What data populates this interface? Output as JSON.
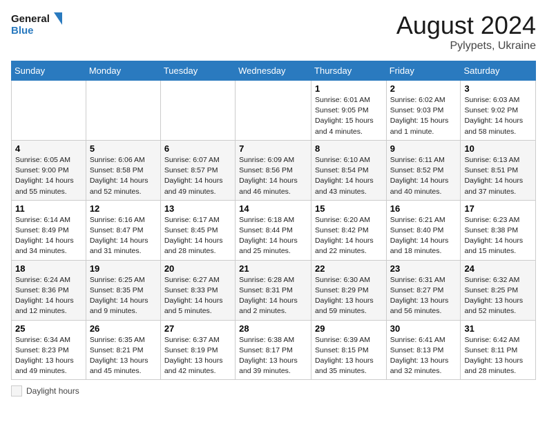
{
  "logo": {
    "line1": "General",
    "line2": "Blue"
  },
  "title": "August 2024",
  "subtitle": "Pylypets, Ukraine",
  "weekdays": [
    "Sunday",
    "Monday",
    "Tuesday",
    "Wednesday",
    "Thursday",
    "Friday",
    "Saturday"
  ],
  "legend_label": "Daylight hours",
  "weeks": [
    [
      {
        "day": "",
        "info": ""
      },
      {
        "day": "",
        "info": ""
      },
      {
        "day": "",
        "info": ""
      },
      {
        "day": "",
        "info": ""
      },
      {
        "day": "1",
        "info": "Sunrise: 6:01 AM\nSunset: 9:05 PM\nDaylight: 15 hours\nand 4 minutes."
      },
      {
        "day": "2",
        "info": "Sunrise: 6:02 AM\nSunset: 9:03 PM\nDaylight: 15 hours\nand 1 minute."
      },
      {
        "day": "3",
        "info": "Sunrise: 6:03 AM\nSunset: 9:02 PM\nDaylight: 14 hours\nand 58 minutes."
      }
    ],
    [
      {
        "day": "4",
        "info": "Sunrise: 6:05 AM\nSunset: 9:00 PM\nDaylight: 14 hours\nand 55 minutes."
      },
      {
        "day": "5",
        "info": "Sunrise: 6:06 AM\nSunset: 8:58 PM\nDaylight: 14 hours\nand 52 minutes."
      },
      {
        "day": "6",
        "info": "Sunrise: 6:07 AM\nSunset: 8:57 PM\nDaylight: 14 hours\nand 49 minutes."
      },
      {
        "day": "7",
        "info": "Sunrise: 6:09 AM\nSunset: 8:56 PM\nDaylight: 14 hours\nand 46 minutes."
      },
      {
        "day": "8",
        "info": "Sunrise: 6:10 AM\nSunset: 8:54 PM\nDaylight: 14 hours\nand 43 minutes."
      },
      {
        "day": "9",
        "info": "Sunrise: 6:11 AM\nSunset: 8:52 PM\nDaylight: 14 hours\nand 40 minutes."
      },
      {
        "day": "10",
        "info": "Sunrise: 6:13 AM\nSunset: 8:51 PM\nDaylight: 14 hours\nand 37 minutes."
      }
    ],
    [
      {
        "day": "11",
        "info": "Sunrise: 6:14 AM\nSunset: 8:49 PM\nDaylight: 14 hours\nand 34 minutes."
      },
      {
        "day": "12",
        "info": "Sunrise: 6:16 AM\nSunset: 8:47 PM\nDaylight: 14 hours\nand 31 minutes."
      },
      {
        "day": "13",
        "info": "Sunrise: 6:17 AM\nSunset: 8:45 PM\nDaylight: 14 hours\nand 28 minutes."
      },
      {
        "day": "14",
        "info": "Sunrise: 6:18 AM\nSunset: 8:44 PM\nDaylight: 14 hours\nand 25 minutes."
      },
      {
        "day": "15",
        "info": "Sunrise: 6:20 AM\nSunset: 8:42 PM\nDaylight: 14 hours\nand 22 minutes."
      },
      {
        "day": "16",
        "info": "Sunrise: 6:21 AM\nSunset: 8:40 PM\nDaylight: 14 hours\nand 18 minutes."
      },
      {
        "day": "17",
        "info": "Sunrise: 6:23 AM\nSunset: 8:38 PM\nDaylight: 14 hours\nand 15 minutes."
      }
    ],
    [
      {
        "day": "18",
        "info": "Sunrise: 6:24 AM\nSunset: 8:36 PM\nDaylight: 14 hours\nand 12 minutes."
      },
      {
        "day": "19",
        "info": "Sunrise: 6:25 AM\nSunset: 8:35 PM\nDaylight: 14 hours\nand 9 minutes."
      },
      {
        "day": "20",
        "info": "Sunrise: 6:27 AM\nSunset: 8:33 PM\nDaylight: 14 hours\nand 5 minutes."
      },
      {
        "day": "21",
        "info": "Sunrise: 6:28 AM\nSunset: 8:31 PM\nDaylight: 14 hours\nand 2 minutes."
      },
      {
        "day": "22",
        "info": "Sunrise: 6:30 AM\nSunset: 8:29 PM\nDaylight: 13 hours\nand 59 minutes."
      },
      {
        "day": "23",
        "info": "Sunrise: 6:31 AM\nSunset: 8:27 PM\nDaylight: 13 hours\nand 56 minutes."
      },
      {
        "day": "24",
        "info": "Sunrise: 6:32 AM\nSunset: 8:25 PM\nDaylight: 13 hours\nand 52 minutes."
      }
    ],
    [
      {
        "day": "25",
        "info": "Sunrise: 6:34 AM\nSunset: 8:23 PM\nDaylight: 13 hours\nand 49 minutes."
      },
      {
        "day": "26",
        "info": "Sunrise: 6:35 AM\nSunset: 8:21 PM\nDaylight: 13 hours\nand 45 minutes."
      },
      {
        "day": "27",
        "info": "Sunrise: 6:37 AM\nSunset: 8:19 PM\nDaylight: 13 hours\nand 42 minutes."
      },
      {
        "day": "28",
        "info": "Sunrise: 6:38 AM\nSunset: 8:17 PM\nDaylight: 13 hours\nand 39 minutes."
      },
      {
        "day": "29",
        "info": "Sunrise: 6:39 AM\nSunset: 8:15 PM\nDaylight: 13 hours\nand 35 minutes."
      },
      {
        "day": "30",
        "info": "Sunrise: 6:41 AM\nSunset: 8:13 PM\nDaylight: 13 hours\nand 32 minutes."
      },
      {
        "day": "31",
        "info": "Sunrise: 6:42 AM\nSunset: 8:11 PM\nDaylight: 13 hours\nand 28 minutes."
      }
    ]
  ]
}
